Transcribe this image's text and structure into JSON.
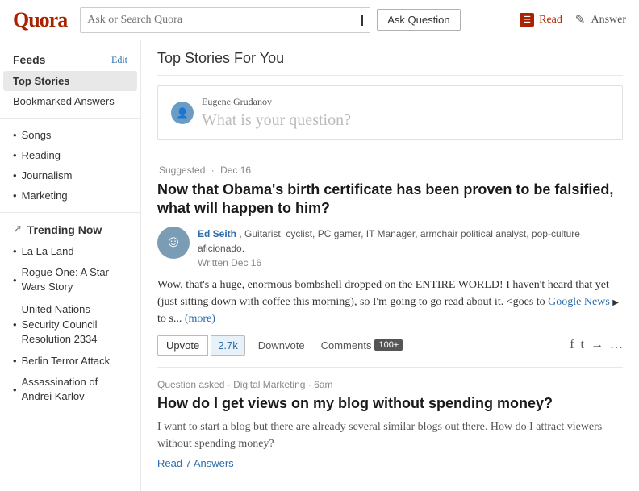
{
  "header": {
    "logo": "Quora",
    "search_placeholder": "Ask or Search Quora",
    "ask_question_label": "Ask Question",
    "nav": [
      {
        "label": "Read",
        "active": true,
        "icon": "read-icon"
      },
      {
        "label": "Answer",
        "active": false,
        "icon": "answer-icon"
      }
    ]
  },
  "sidebar": {
    "feeds_label": "Feeds",
    "edit_label": "Edit",
    "items": [
      {
        "label": "Top Stories",
        "active": true
      },
      {
        "label": "Bookmarked Answers",
        "active": false
      }
    ],
    "sub_items": [
      {
        "label": "Songs"
      },
      {
        "label": "Reading"
      },
      {
        "label": "Journalism"
      },
      {
        "label": "Marketing"
      }
    ],
    "trending_label": "Trending Now",
    "trending_items": [
      {
        "label": "La La Land"
      },
      {
        "label": "Rogue One: A Star Wars Story"
      },
      {
        "label": "United Nations Security Council Resolution 2334"
      },
      {
        "label": "Berlin Terror Attack"
      },
      {
        "label": "Assassination of Andrei Karlov"
      }
    ]
  },
  "main": {
    "section_title": "Top Stories For You",
    "ask_box": {
      "user_name": "Eugene Grudanov",
      "placeholder": "What is your question?"
    },
    "stories": [
      {
        "meta_suggested": "Suggested",
        "meta_date": "Dec 16",
        "title": "Now that Obama's birth certificate has been proven to be falsified, what will happen to him?",
        "author_name": "Ed Seith",
        "author_desc": "Guitarist, cyclist, PC gamer, IT Manager, armchair political analyst, pop-culture aficionado.",
        "author_written": "Written Dec 16",
        "text_start": "Wow, that's a huge, enormous bombshell dropped on the ENTIRE WORLD! I haven't heard that yet (just sitting down with coffee this morning), so I'm going to go read about it. <goes to ",
        "text_link": "Google News",
        "text_end": " to s...",
        "more_label": "(more)",
        "upvote_label": "Upvote",
        "upvote_count": "2.7k",
        "downvote_label": "Downvote",
        "comments_label": "Comments",
        "comments_count": "100+"
      },
      {
        "meta_question": "Question asked",
        "meta_topic": "Digital Marketing",
        "meta_time": "6am",
        "title": "How do I get views on my blog without spending money?",
        "text": "I want to start a blog but there are already several similar blogs out there. How do I attract viewers without spending money?",
        "read_label": "Read 7 Answers"
      }
    ]
  }
}
